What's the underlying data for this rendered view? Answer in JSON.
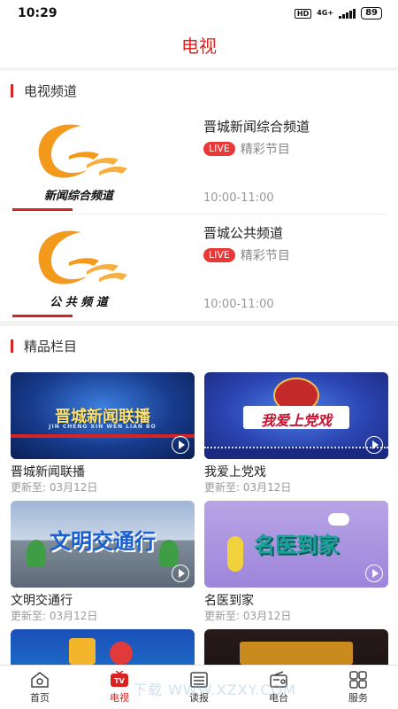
{
  "status": {
    "time": "10:29",
    "hd": "HD",
    "network": "4G+",
    "battery": "89"
  },
  "header": {
    "title": "电视"
  },
  "sections": {
    "channels": "电视频道",
    "programs": "精品栏目"
  },
  "channels": [
    {
      "name": "晋城新闻综合频道",
      "live": "LIVE",
      "live_text": "精彩节目",
      "time": "10:00-11:00",
      "logo_text": "新闻综合频道"
    },
    {
      "name": "晋城公共频道",
      "live": "LIVE",
      "live_text": "精彩节目",
      "time": "10:00-11:00",
      "logo_text": "公 共 频 道"
    }
  ],
  "programs": [
    {
      "title": "晋城新闻联播",
      "meta": "更新至:  03月12日",
      "thumb_text": "晋城新闻联播",
      "thumb_sub": "JIN CHENG XIN WEN LIAN BO"
    },
    {
      "title": "我爱上党戏",
      "meta": "更新至:  03月12日",
      "thumb_text": "我爱上党戏"
    },
    {
      "title": "文明交通行",
      "meta": "更新至:  03月12日",
      "thumb_text": "文明交通行"
    },
    {
      "title": "名医到家",
      "meta": "更新至:  03月12日",
      "thumb_text": "名医到家"
    }
  ],
  "nav": [
    {
      "label": "首页",
      "icon": "home-icon"
    },
    {
      "label": "电视",
      "icon": "tv-icon",
      "active": true,
      "icon_text": "TV"
    },
    {
      "label": "读报",
      "icon": "newspaper-icon"
    },
    {
      "label": "电台",
      "icon": "radio-icon"
    },
    {
      "label": "服务",
      "icon": "services-icon"
    }
  ],
  "watermark": "下载  WWW.XZXY.COM",
  "colors": {
    "accent": "#d82323",
    "live": "#e83838",
    "logo_orange": "#f39a1c"
  }
}
